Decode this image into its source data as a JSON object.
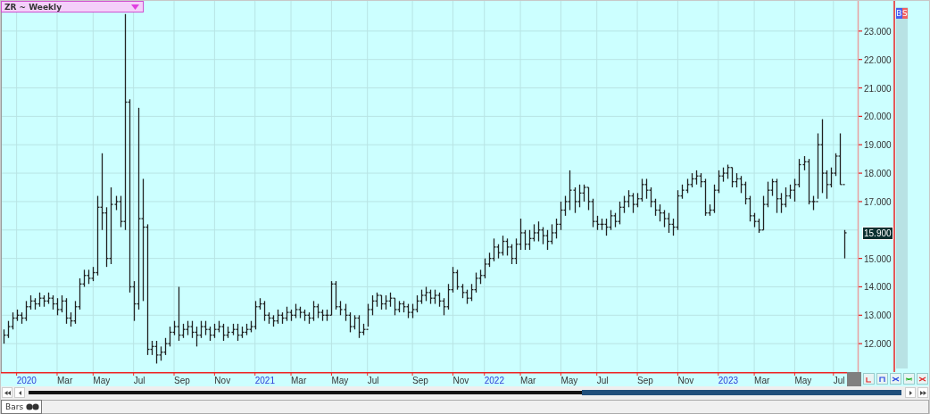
{
  "title_dropdown": {
    "label": "ZR ~ Weekly"
  },
  "chart": {
    "last_price": "15.900",
    "price_labels": [
      "23.000",
      "22.000",
      "21.000",
      "20.000",
      "19.000",
      "18.000",
      "17.000",
      "15.000",
      "14.000",
      "13.000",
      "12.000"
    ],
    "date_labels": [
      {
        "label": "2020",
        "kind": "year"
      },
      {
        "label": "Mar",
        "kind": "month"
      },
      {
        "label": "May",
        "kind": "month"
      },
      {
        "label": "Jul",
        "kind": "month"
      },
      {
        "label": "Sep",
        "kind": "month"
      },
      {
        "label": "Nov",
        "kind": "month"
      },
      {
        "label": "2021",
        "kind": "year"
      },
      {
        "label": "Mar",
        "kind": "month"
      },
      {
        "label": "May",
        "kind": "month"
      },
      {
        "label": "Jul",
        "kind": "month"
      },
      {
        "label": "Sep",
        "kind": "month"
      },
      {
        "label": "Nov",
        "kind": "month"
      },
      {
        "label": "2022",
        "kind": "year"
      },
      {
        "label": "Mar",
        "kind": "month"
      },
      {
        "label": "May",
        "kind": "month"
      },
      {
        "label": "Jul",
        "kind": "month"
      },
      {
        "label": "Sep",
        "kind": "month"
      },
      {
        "label": "Nov",
        "kind": "month"
      },
      {
        "label": "2023",
        "kind": "year"
      },
      {
        "label": "Mar",
        "kind": "month"
      },
      {
        "label": "May",
        "kind": "month"
      },
      {
        "label": "Jul",
        "kind": "month"
      }
    ]
  },
  "order_badges": [
    {
      "label": "B",
      "color": "#4a5df0"
    },
    {
      "label": "S",
      "color": "#f06060"
    }
  ],
  "status_bar": {
    "tabs": [
      {
        "label": "Bars",
        "selected": true
      }
    ]
  }
}
